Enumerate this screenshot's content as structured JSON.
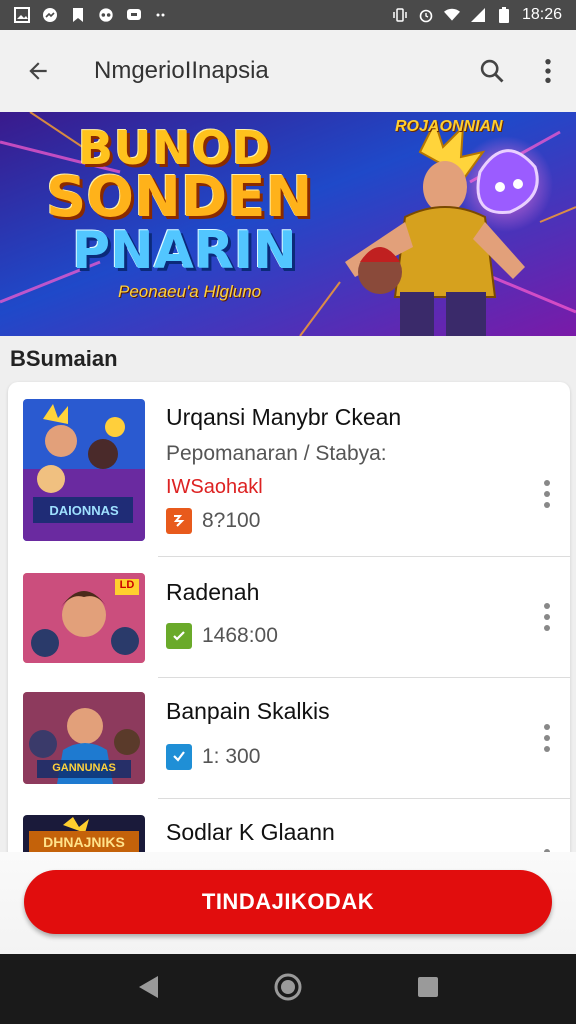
{
  "status_bar": {
    "time": "18:26",
    "left_icons": [
      "gallery-icon",
      "messenger-icon",
      "bookmark-icon",
      "game-controller-icon",
      "message-icon",
      "more-dots-icon"
    ],
    "right_icons": [
      "vibrate-icon",
      "alarm-icon",
      "wifi-icon",
      "signal-icon",
      "battery-icon"
    ]
  },
  "app_bar": {
    "title": "NmgerioIInapsia"
  },
  "banner": {
    "line1": "BUNOD",
    "line2": "SONDEN",
    "line3": "PNARIN",
    "tagline": "Peonaeu'a Hlgluno",
    "badge": "ROJAONNIAN"
  },
  "section": {
    "title": "BSumaian"
  },
  "list": [
    {
      "name": "Urqansi Manybr Ckean",
      "subtitle": "Pepomanaran / Stabya:",
      "tag": "IWSaohakl",
      "stat": "8?100",
      "stat_icon_color": "#e85a1c",
      "thumb_text": "DAIONNAS"
    },
    {
      "name": "Radenah",
      "stat": "1468:00",
      "stat_icon_color": "#6aaa2a",
      "thumb_text": "LD"
    },
    {
      "name": "Banpain Skalkis",
      "stat": "1: 300",
      "stat_icon_color": "#1f8fd6",
      "thumb_text": "GANNUNAS"
    },
    {
      "name": "Sodlar K Glaann",
      "thumb_text": "DHNAJNIKS"
    }
  ],
  "cta": {
    "label": "TINDAJIKODAK"
  },
  "colors": {
    "accent": "#e10d0d",
    "status_bar": "#4a4a4a",
    "nav_bar": "#1a1a1a"
  }
}
